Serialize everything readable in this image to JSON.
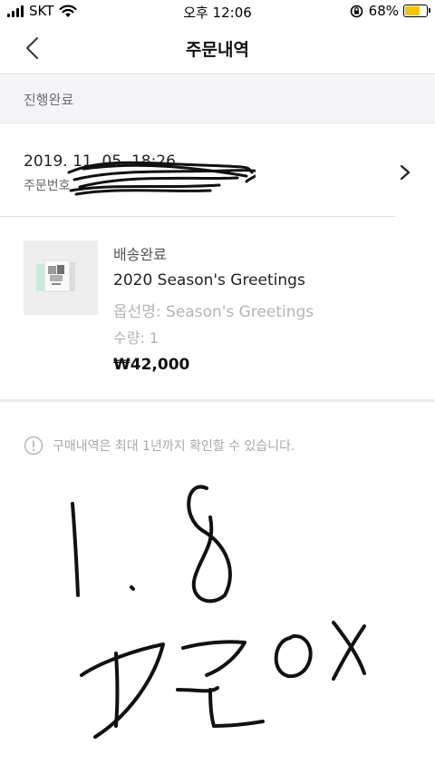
{
  "status_bar": {
    "carrier": "SKT",
    "time": "오후 12:06",
    "battery_percent": "68%",
    "battery_level": 0.68,
    "battery_color": "#f5c400"
  },
  "nav": {
    "title": "주문내역",
    "back_icon": "chevron-left-icon"
  },
  "order": {
    "status": "진행완료",
    "datetime": "2019. 11. 05. 18:26",
    "number_label": "주문번호",
    "detail_icon": "chevron-right-icon"
  },
  "product": {
    "delivery_status": "배송완료",
    "name": "2020 Season's Greetings",
    "option": "옵선명: Season's Greetings",
    "quantity": "수량: 1",
    "price": "₩42,000"
  },
  "notice": {
    "icon": "info-icon",
    "text": "구매내역은 최대 1년까지 확인할 수 있습니다."
  },
  "colors": {
    "status_bg": "#f5f5f7",
    "muted_text": "#b4b4b4"
  }
}
